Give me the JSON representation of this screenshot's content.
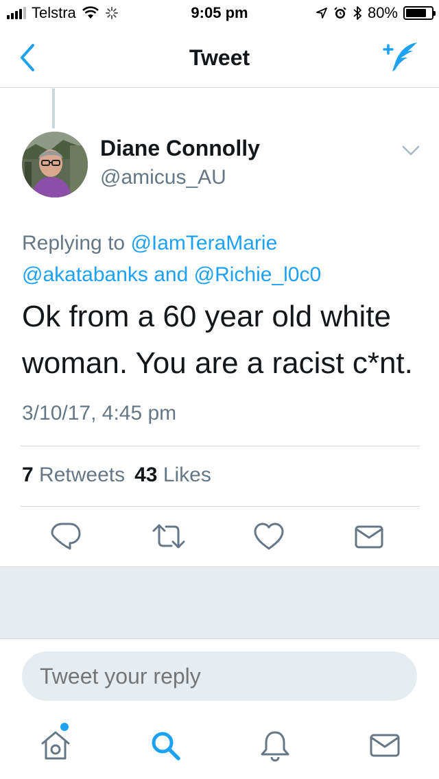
{
  "status_bar": {
    "carrier": "Telstra",
    "time": "9:05 pm",
    "battery_percent": "80%",
    "battery_level": 0.8
  },
  "nav": {
    "title": "Tweet"
  },
  "tweet": {
    "author_name": "Diane Connolly",
    "author_handle": "@amicus_AU",
    "replying_to_prefix": "Replying to ",
    "mention_1": "@IamTeraMarie",
    "mention_2": "@akatabanks",
    "mention_joiner": " and ",
    "mention_3": "@Richie_l0c0",
    "text_line_1": "Ok from a 60 year old white",
    "text_line_2": "woman. You are a racist c*nt.",
    "timestamp": "3/10/17, 4:45 pm",
    "retweet_count": "7",
    "retweet_label": "Retweets",
    "like_count": "43",
    "like_label": "Likes"
  },
  "reply": {
    "placeholder": "Tweet your reply"
  },
  "colors": {
    "brand": "#1da1f2",
    "text_primary": "#14171a",
    "text_secondary": "#657786",
    "background_gray": "#e6ecf0"
  },
  "icons": {
    "back": "chevron-left-icon",
    "compose": "compose-tweet-icon",
    "reply": "reply-bubble-icon",
    "retweet": "retweet-icon",
    "like": "heart-icon",
    "dm": "envelope-icon",
    "home": "home-icon",
    "search": "search-icon",
    "notifications": "bell-icon",
    "messages": "envelope-icon"
  }
}
